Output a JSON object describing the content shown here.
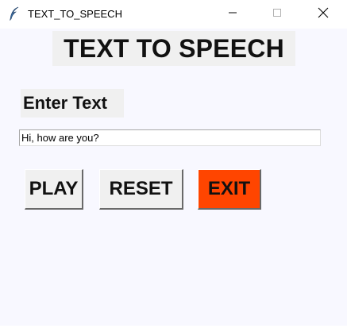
{
  "window": {
    "title": "TEXT_TO_SPEECH",
    "icon": "feather-icon",
    "background_color": "#F8F8FF",
    "controls": {
      "minimize_icon": "minimize-icon",
      "maximize_icon": "maximize-icon",
      "close_icon": "close-icon"
    }
  },
  "main": {
    "heading": "TEXT TO SPEECH",
    "input_label": "Enter Text",
    "text_input": {
      "value": "Hi, how are you?",
      "placeholder": ""
    }
  },
  "buttons": {
    "play_label": "PLAY",
    "reset_label": "RESET",
    "exit_label": "EXIT",
    "exit_color": "#FF4500",
    "default_color": "#F0F0F0"
  }
}
